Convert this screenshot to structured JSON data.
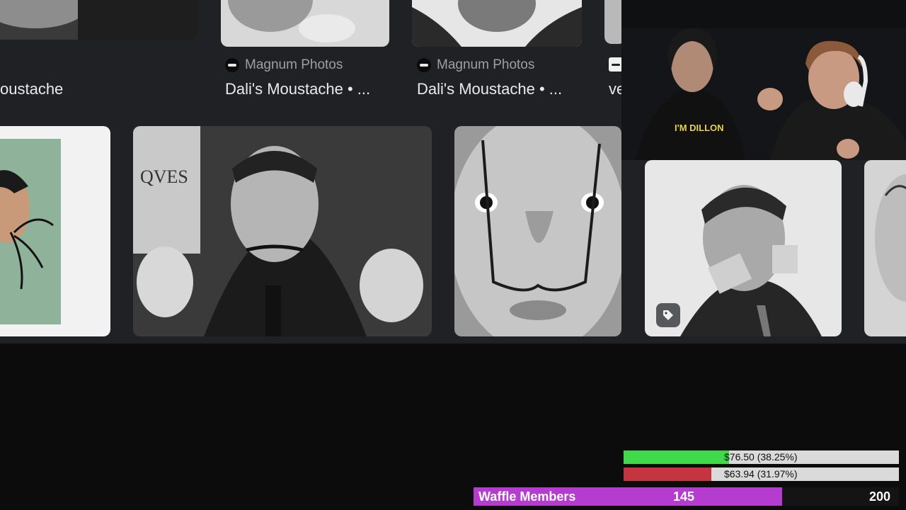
{
  "results_row1": [
    {
      "source": "",
      "title": "oustache"
    },
    {
      "source": "Magnum Photos",
      "title": "Dali's Moustache • ..."
    },
    {
      "source": "Magnum Photos",
      "title": "Dali's Moustache • ..."
    },
    {
      "source": "",
      "title": "ve"
    }
  ],
  "webcam": {
    "shirt_text": "I'M DILLON"
  },
  "donations": [
    {
      "label": "$76.50 (38.25%)",
      "percent": 38.25,
      "color": "#3fd94a"
    },
    {
      "label": "$63.94 (31.97%)",
      "percent": 31.97,
      "color": "#c4353f"
    }
  ],
  "members": {
    "label": "Waffle Members",
    "current": "145",
    "goal": "200",
    "fraction": 0.725
  },
  "icons": {
    "source_logo": "magnum-logo-icon",
    "tag": "tag-icon"
  }
}
